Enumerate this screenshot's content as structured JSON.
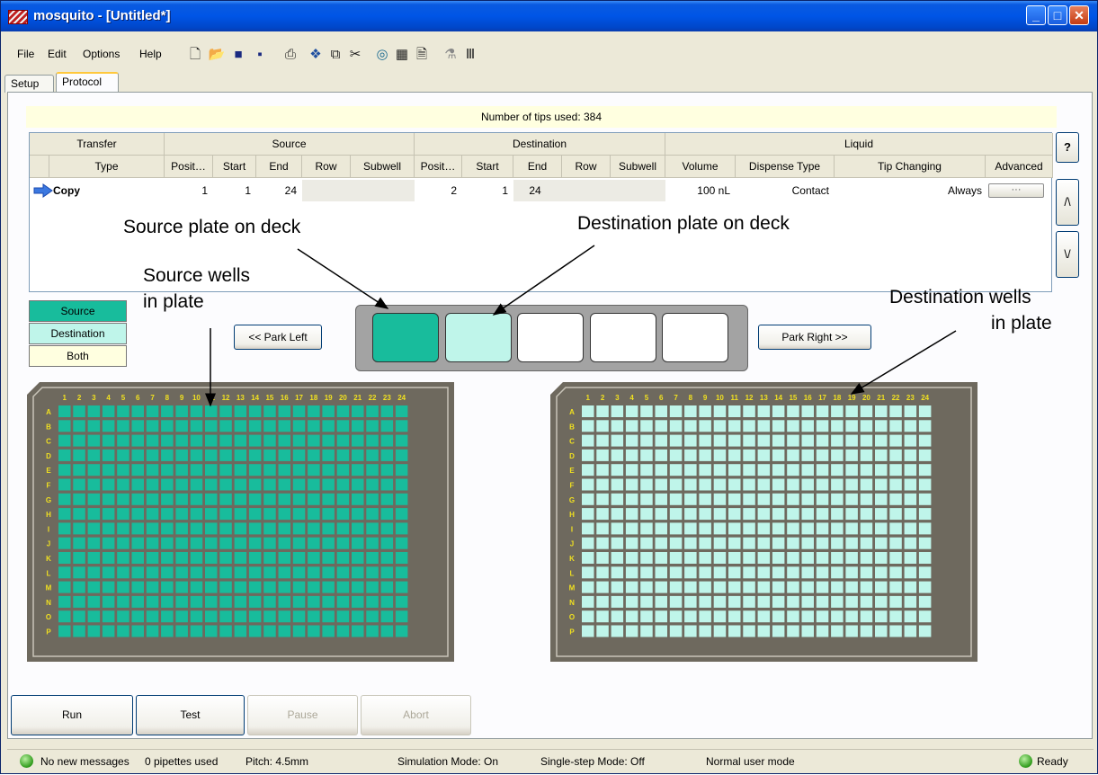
{
  "window": {
    "title": "mosquito - [Untitled*]",
    "min": "_",
    "max": "□",
    "close": "✕"
  },
  "menu": [
    "File",
    "Edit",
    "Options",
    "Help"
  ],
  "toolbar_icons": [
    "new-icon",
    "open-icon",
    "save-icon",
    "save-as-icon",
    "print-icon",
    "plate-icon",
    "copy-icon",
    "cut-icon",
    "target-icon",
    "grid-icon",
    "document-icon",
    "pipette-icon",
    "tips-icon"
  ],
  "tabs": [
    "Setup",
    "Protocol"
  ],
  "tips_used": "Number of tips used: 384",
  "grid": {
    "groups": [
      "Transfer",
      "Source",
      "Destination",
      "Liquid"
    ],
    "columns": [
      "Type",
      "Posit…",
      "Start",
      "End",
      "Row",
      "Subwell",
      "Posit…",
      "Start",
      "End",
      "Row",
      "Subwell",
      "Volume",
      "Dispense Type",
      "Tip Changing",
      "Advanced"
    ],
    "row": {
      "type": "Copy",
      "src_pos": "1",
      "src_start": "1",
      "src_end": "24",
      "dst_pos": "2",
      "dst_start": "1",
      "dst_end": "24",
      "volume": "100 nL",
      "dispense": "Contact",
      "tip_changing": "Always",
      "advanced": "···"
    }
  },
  "side_buttons": {
    "help": "?",
    "up": "/\\",
    "down": "\\/"
  },
  "legend": {
    "source": "Source",
    "destination": "Destination",
    "both": "Both",
    "source_color": "#18bc9c",
    "destination_color": "#bff5ea",
    "both_color": "#ffffe0"
  },
  "park_left": "<< Park Left",
  "park_right": "Park Right >>",
  "deck": {
    "slots": [
      "source",
      "destination",
      "empty",
      "empty",
      "empty"
    ]
  },
  "plate": {
    "rows": [
      "A",
      "B",
      "C",
      "D",
      "E",
      "F",
      "G",
      "H",
      "I",
      "J",
      "K",
      "L",
      "M",
      "N",
      "O",
      "P"
    ],
    "cols": [
      "1",
      "2",
      "3",
      "4",
      "5",
      "6",
      "7",
      "8",
      "9",
      "10",
      "11",
      "12",
      "13",
      "14",
      "15",
      "16",
      "17",
      "18",
      "19",
      "20",
      "21",
      "22",
      "23",
      "24"
    ],
    "body_color": "#6e695e",
    "label_color": "#f0e020"
  },
  "annotations": {
    "source_plate": "Source plate on deck",
    "dest_plate": "Destination plate on deck",
    "source_wells_1": "Source wells",
    "source_wells_2": "in plate",
    "dest_wells_1": "Destination wells",
    "dest_wells_2": "in plate"
  },
  "actions": {
    "run": "Run",
    "test": "Test",
    "pause": "Pause",
    "abort": "Abort"
  },
  "status": {
    "messages": "No new messages",
    "pipettes": "0 pipettes used",
    "pitch": "Pitch: 4.5mm",
    "simulation": "Simulation Mode: On",
    "single_step": "Single-step Mode: Off",
    "user_mode": "Normal user mode",
    "ready": "Ready"
  }
}
